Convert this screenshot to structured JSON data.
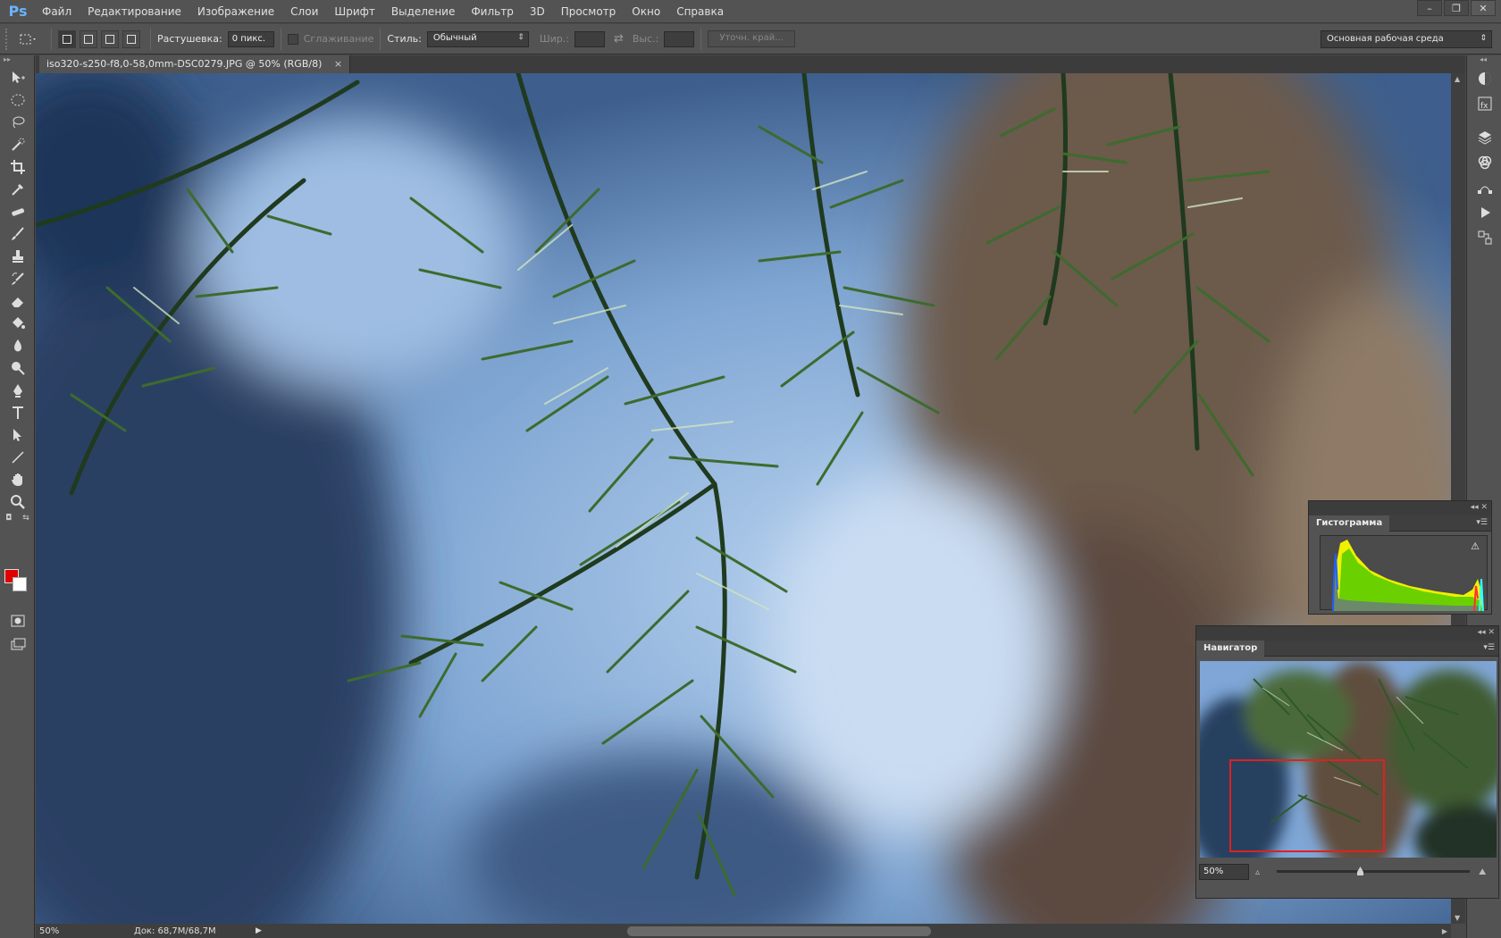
{
  "app": {
    "logo": "Ps"
  },
  "menu": [
    "Файл",
    "Редактирование",
    "Изображение",
    "Слои",
    "Шрифт",
    "Выделение",
    "Фильтр",
    "3D",
    "Просмотр",
    "Окно",
    "Справка"
  ],
  "window_controls": {
    "minimize": "–",
    "restore": "❐",
    "close": "✕"
  },
  "options": {
    "feather_label": "Растушевка:",
    "feather_value": "0 пикс.",
    "antialias_label": "Сглаживание",
    "style_label": "Стиль:",
    "style_value": "Обычный",
    "width_label": "Шир.:",
    "height_label": "Выс.:",
    "refine_edge": "Уточн. край...",
    "workspace": "Основная рабочая среда"
  },
  "document": {
    "tab_title": "iso320-s250-f8,0-58,0mm-DSC0279.JPG @ 50% (RGB/8)",
    "close": "×"
  },
  "status": {
    "zoom": "50%",
    "doc": "Док: 68,7M/68,7M"
  },
  "histogram": {
    "title": "Гистограмма",
    "warning": "⚠"
  },
  "navigator": {
    "title": "Навигатор",
    "zoom": "50%"
  },
  "colors": {
    "foreground": "#e00000",
    "background": "#ffffff"
  }
}
